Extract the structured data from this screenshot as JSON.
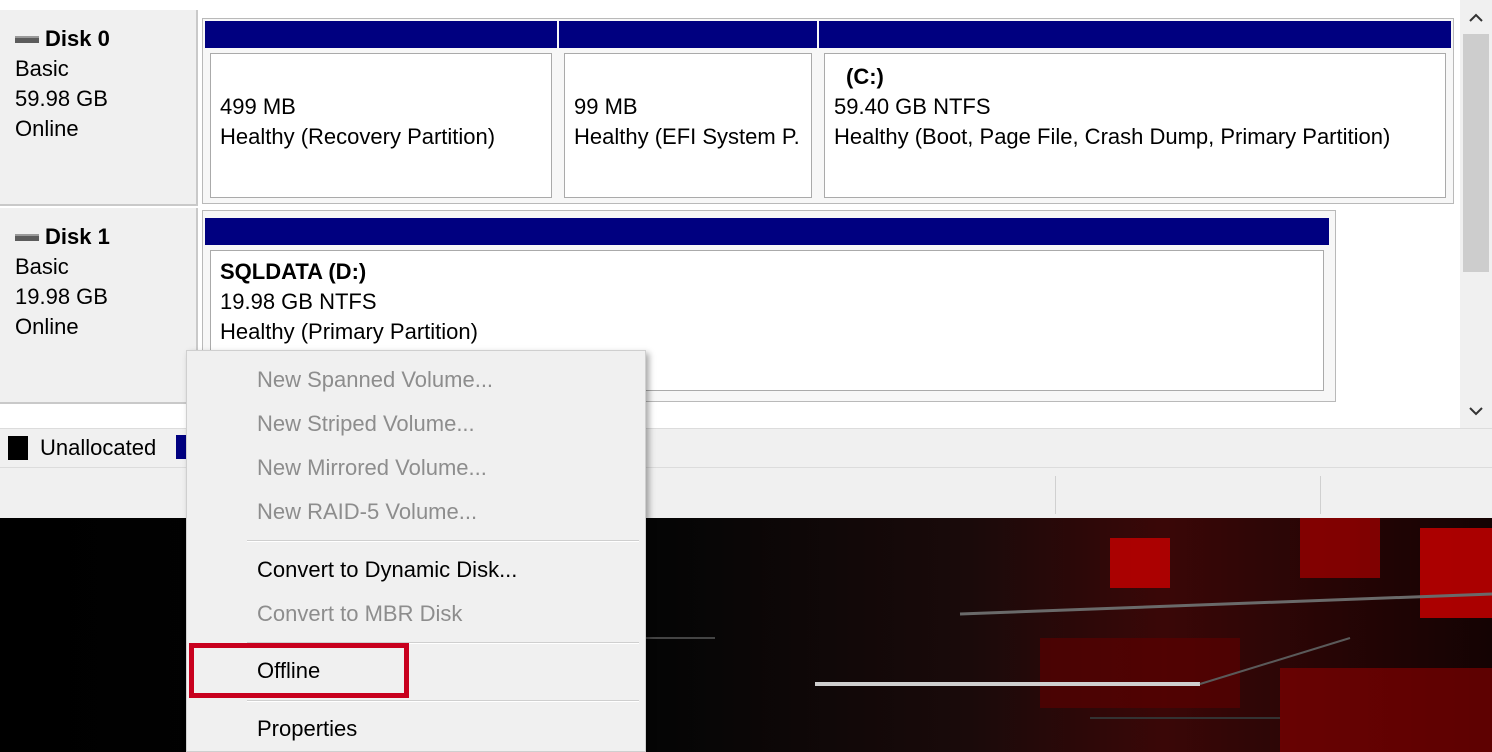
{
  "disks": [
    {
      "title": "Disk 0",
      "type": "Basic",
      "size": "59.98 GB",
      "status": "Online",
      "volumes": [
        {
          "name": "",
          "line1": "499 MB",
          "line2": "Healthy (Recovery Partition)"
        },
        {
          "name": "",
          "line1": "99 MB",
          "line2": "Healthy (EFI System P."
        },
        {
          "name": "(C:)",
          "line1": "59.40 GB NTFS",
          "line2": "Healthy (Boot, Page File, Crash Dump, Primary Partition)"
        }
      ]
    },
    {
      "title": "Disk 1",
      "type": "Basic",
      "size": "19.98 GB",
      "status": "Online",
      "volumes": [
        {
          "name": "SQLDATA  (D:)",
          "line1": "19.98 GB NTFS",
          "line2": "Healthy (Primary Partition)"
        }
      ]
    }
  ],
  "legend": {
    "unallocated": "Unallocated",
    "unallocated_color": "#000000",
    "primary_color": "#000080"
  },
  "context_menu": {
    "items": [
      {
        "label": "New Spanned Volume...",
        "enabled": false
      },
      {
        "label": "New Striped Volume...",
        "enabled": false
      },
      {
        "label": "New Mirrored Volume...",
        "enabled": false
      },
      {
        "label": "New RAID-5 Volume...",
        "enabled": false
      },
      {
        "label": "Convert to Dynamic Disk...",
        "enabled": true
      },
      {
        "label": "Convert to MBR Disk",
        "enabled": false
      },
      {
        "label": "Offline",
        "enabled": true,
        "highlighted": true
      },
      {
        "label": "Properties",
        "enabled": true
      }
    ]
  },
  "colors": {
    "volume_header": "#000080",
    "highlight_border": "#c8001e",
    "wallpaper_accent": "#c00000"
  },
  "icons": {
    "disk": "disk-drive-icon",
    "scroll_up": "chevron-up-icon",
    "scroll_down": "chevron-down-icon"
  }
}
